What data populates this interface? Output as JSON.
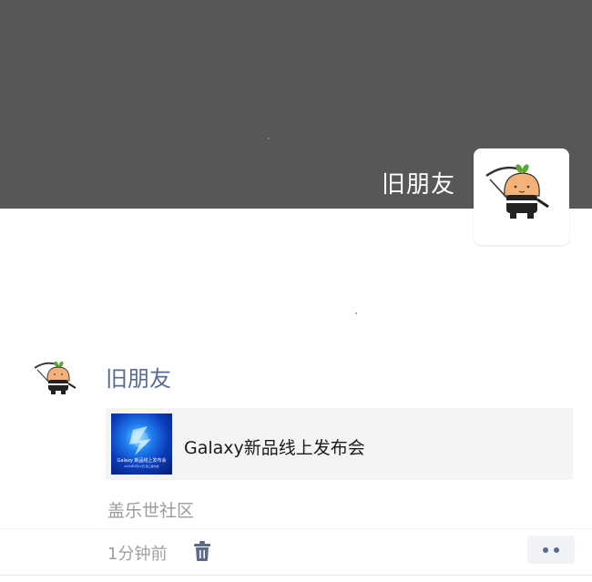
{
  "cover": {
    "name": "旧朋友"
  },
  "post": {
    "author": "旧朋友",
    "share": {
      "title": "Galaxy新品线上发布会",
      "thumb_text": "Galaxy 新品线上发布会",
      "thumb_subtext": "2020年2月12日 线上发布会"
    },
    "source": "盖乐世社区",
    "time": "1分钟前"
  },
  "icons": {
    "avatar": "cartoon-ninja-avatar-icon",
    "delete": "trash-icon",
    "more": "more-dots-icon"
  },
  "colors": {
    "author_link": "#576b95",
    "cover_bg": "#575757",
    "card_bg": "#f4f4f4"
  }
}
